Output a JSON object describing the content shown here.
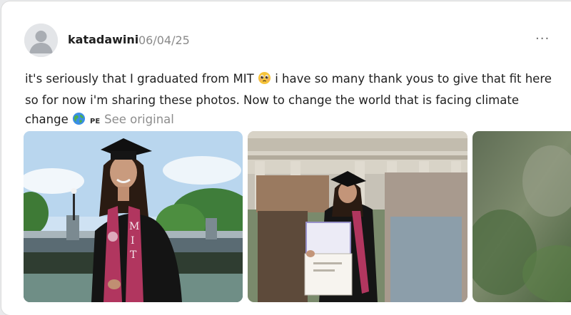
{
  "post": {
    "username": "katadawini",
    "date": "06/04/25",
    "text_1": "it's seriously that I graduated from MIT",
    "text_2": " i have so many thank yous to give that fit here so for now i'm sharing these photos. Now to change the world that is facing climate change",
    "emoji_1": "pleading-face-emoji",
    "emoji_2": "globe-emoji",
    "language_badge": "PE",
    "see_original_label": "See original"
  },
  "photos": [
    {
      "subject": "graduate-in-cap-and-gown",
      "stole_text": [
        "M",
        "I",
        "T"
      ]
    },
    {
      "subject": "graduate-holding-diploma-blurred-crowd"
    },
    {
      "subject": "blurred-greenery"
    }
  ],
  "colors": {
    "card_bg": "#ffffff",
    "stole": "#b1365f",
    "muted_text": "#8a8a8a"
  }
}
